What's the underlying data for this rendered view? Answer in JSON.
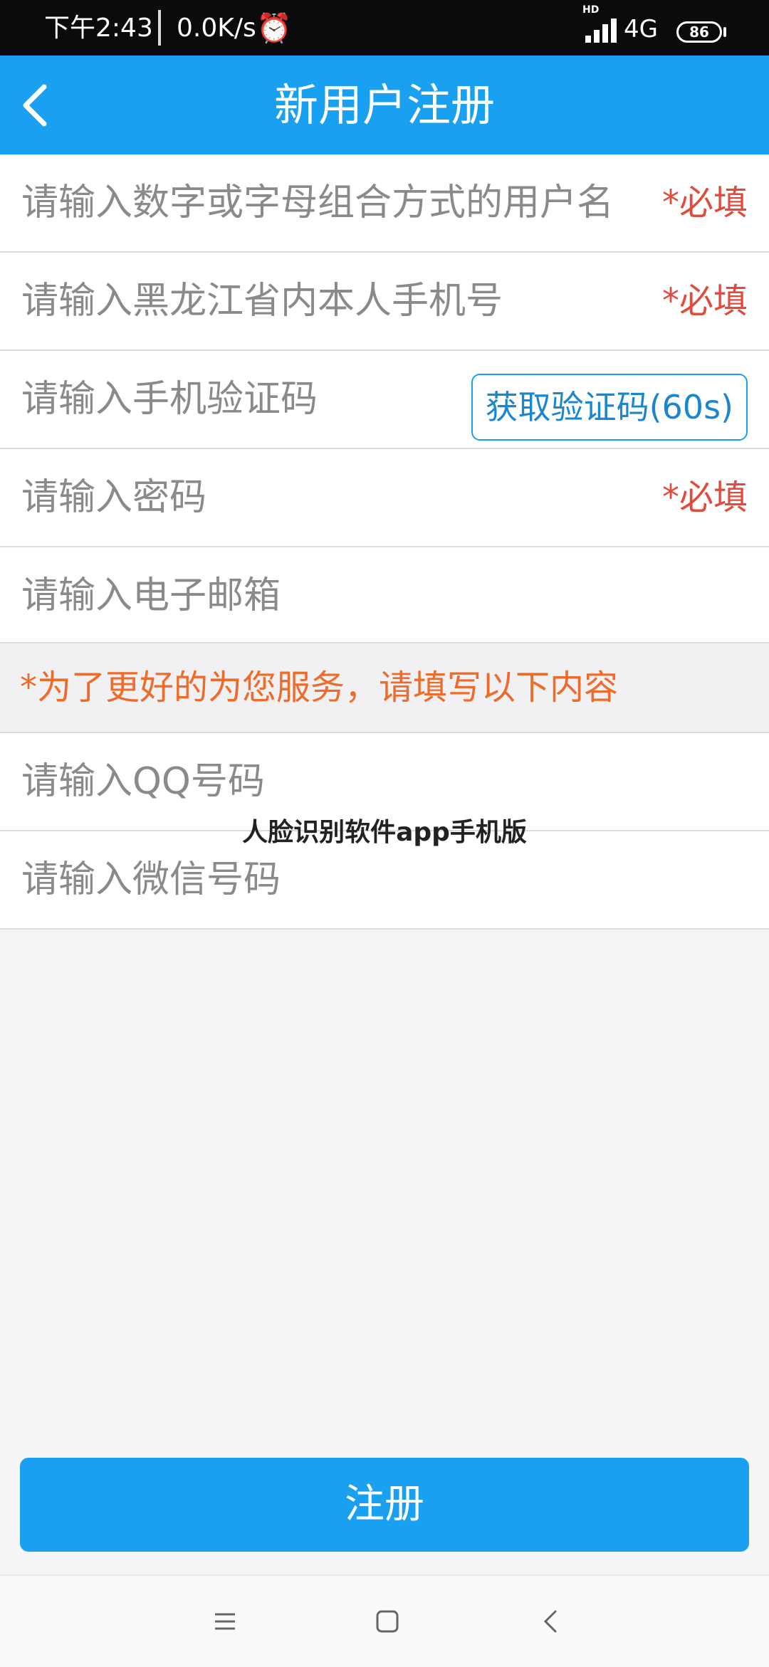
{
  "status_bar": {
    "time": "下午2:43",
    "net_speed": "0.0K/s",
    "network": "4G",
    "battery": "86",
    "hd": "HD"
  },
  "app_bar": {
    "title": "新用户注册",
    "back_icon": "chevron-left-icon"
  },
  "form": {
    "username_placeholder": "请输入数字或字母组合方式的用户名",
    "phone_placeholder": "请输入黑龙江省内本人手机号",
    "code_placeholder": "请输入手机验证码",
    "code_button": "获取验证码(60s)",
    "password_placeholder": "请输入密码",
    "email_placeholder": "请输入电子邮箱",
    "required_label": "*必填",
    "notice": "*为了更好的为您服务，请填写以下内容",
    "qq_placeholder": "请输入QQ号码",
    "wechat_placeholder": "请输入微信号码"
  },
  "watermark": "人脸识别软件app手机版",
  "register_button": "注册",
  "nav": {
    "menu_icon": "menu-icon",
    "home_icon": "home-icon",
    "back_icon": "back-icon"
  },
  "colors": {
    "primary": "#1aa0f0",
    "required": "#e24b3b",
    "notice": "#ef6b2a"
  }
}
